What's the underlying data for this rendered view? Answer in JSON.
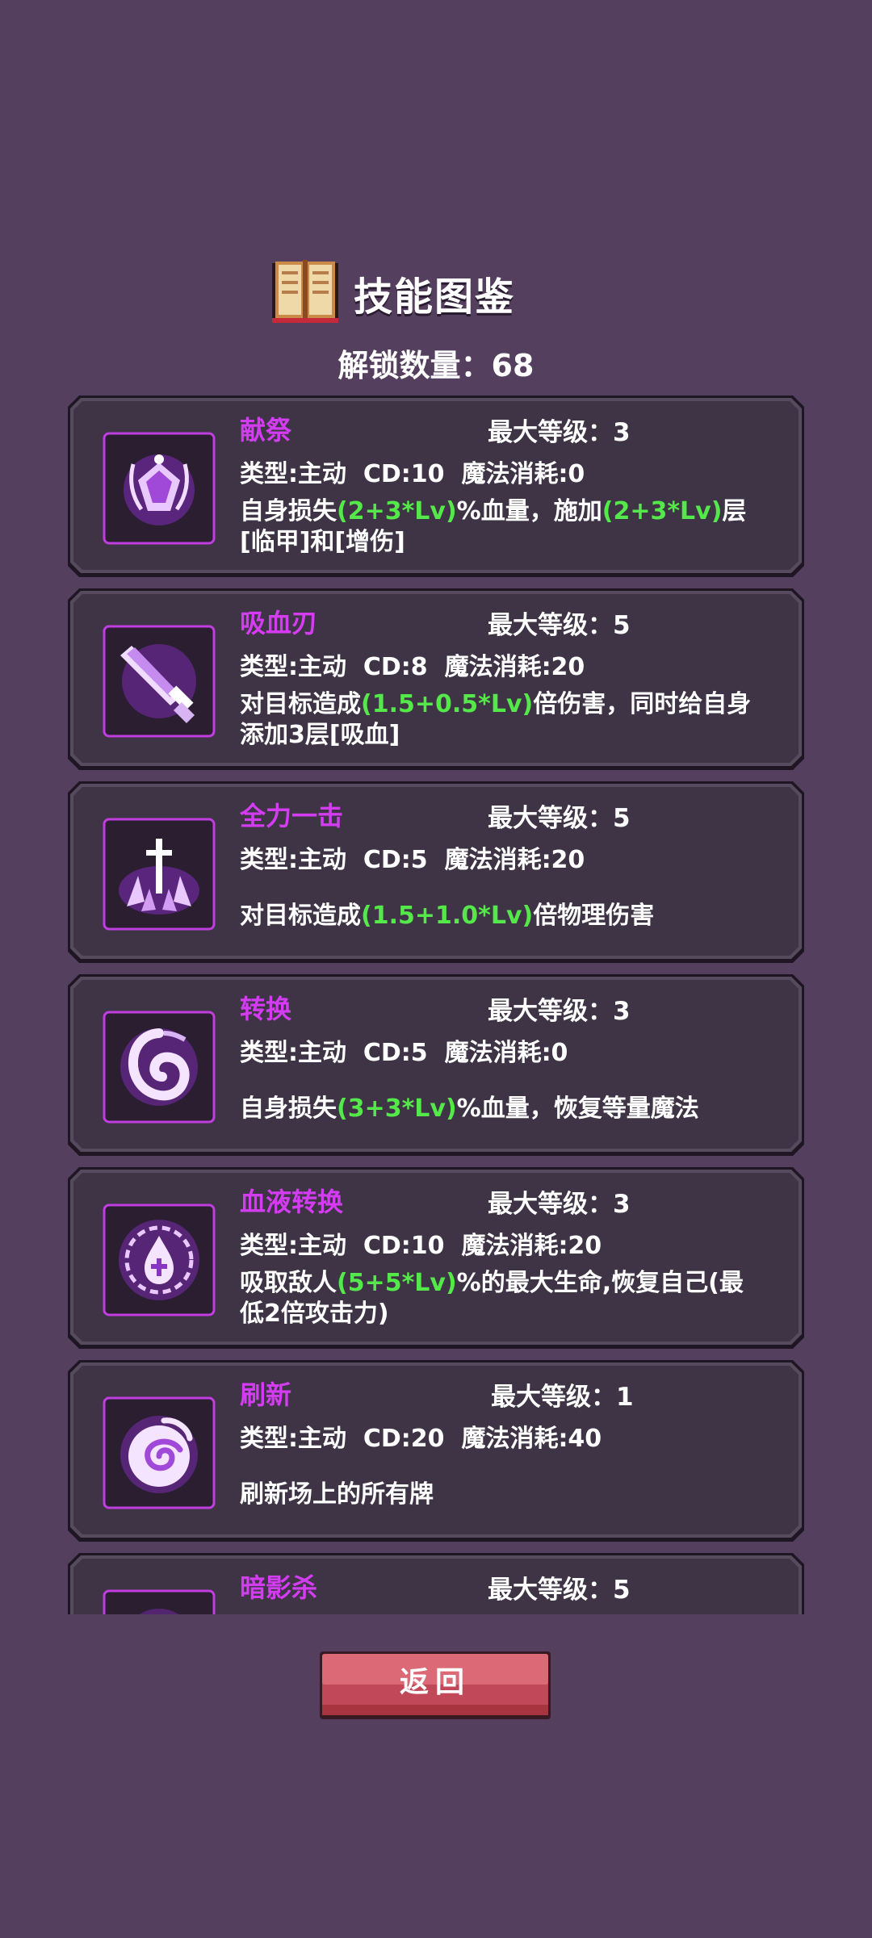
{
  "header": {
    "title": "技能图鉴",
    "unlock_label": "解锁数量：68"
  },
  "skills": [
    {
      "name": "献祭",
      "max_level": "最大等级：3",
      "meta": "类型:主动  CD:10  魔法消耗:0",
      "desc": [
        "自身损失",
        "(2+3*Lv)",
        "%血量，施加",
        "(2+3*Lv)",
        "层[临甲]和[增伤]"
      ],
      "icon": "crowned-gem-icon"
    },
    {
      "name": "吸血刃",
      "max_level": "最大等级：5",
      "meta": "类型:主动  CD:8  魔法消耗:20",
      "desc": [
        "对目标造成",
        "(1.5+0.5*Lv)",
        "倍伤害，同时给自身添加3层[吸血]"
      ],
      "icon": "blade-icon"
    },
    {
      "name": "全力一击",
      "max_level": "最大等级：5",
      "meta": "类型:主动  CD:5  魔法消耗:20",
      "desc": [
        "对目标造成",
        "(1.5+1.0*Lv)",
        "倍物理伤害"
      ],
      "icon": "sword-strike-icon"
    },
    {
      "name": "转换",
      "max_level": "最大等级：3",
      "meta": "类型:主动  CD:5  魔法消耗:0",
      "desc": [
        "自身损失",
        "(3+3*Lv)",
        "%血量，恢复等量魔法"
      ],
      "icon": "swirl-icon"
    },
    {
      "name": "血液转换",
      "max_level": "最大等级：3",
      "meta": "类型:主动  CD:10  魔法消耗:20",
      "desc": [
        "吸取敌人",
        "(5+5*Lv)",
        "%的最大生命,恢复自己(最低2倍攻击力)"
      ],
      "icon": "blood-drop-icon"
    },
    {
      "name": "刷新",
      "max_level": "最大等级：1",
      "meta": "类型:主动  CD:20  魔法消耗:40",
      "desc": [
        "刷新场上的所有牌"
      ],
      "icon": "spiral-icon"
    },
    {
      "name": "暗影杀",
      "max_level": "最大等级：5",
      "meta": "",
      "desc": [],
      "icon": "shadow-icon"
    }
  ],
  "back_button": {
    "label": "返回"
  },
  "colors": {
    "background": "#553f5e",
    "card": "#3e3445",
    "skill_name": "#d43cf2",
    "formula": "#55e84a",
    "button": "#d1525e"
  }
}
